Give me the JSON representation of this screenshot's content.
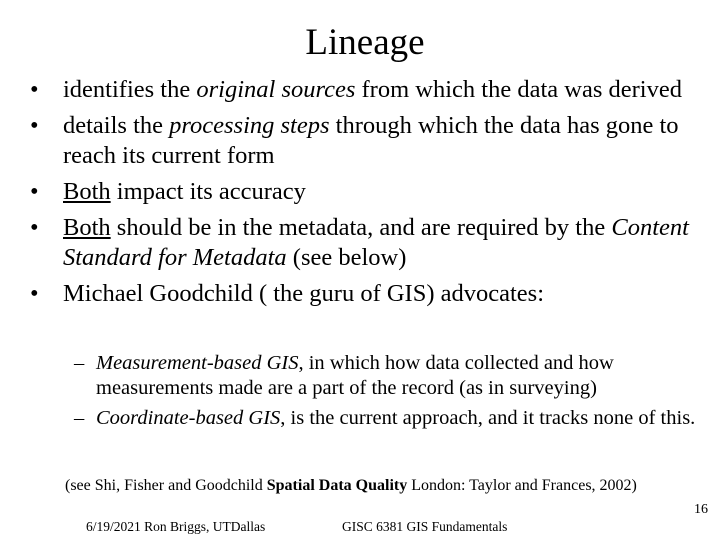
{
  "slide": {
    "title": "Lineage",
    "bullets": [
      {
        "parts": [
          {
            "text": "identifies the ",
            "style": "normal"
          },
          {
            "text": "original sources",
            "style": "italic"
          },
          {
            "text": " from which the data was derived",
            "style": "normal"
          }
        ]
      },
      {
        "parts": [
          {
            "text": "details the ",
            "style": "normal"
          },
          {
            "text": "processing steps",
            "style": "italic"
          },
          {
            "text": " through which the data has gone to reach its current form",
            "style": "normal"
          }
        ]
      },
      {
        "parts": [
          {
            "text": "Both",
            "style": "underline"
          },
          {
            "text": " impact its accuracy",
            "style": "normal"
          }
        ]
      },
      {
        "parts": [
          {
            "text": "Both",
            "style": "underline"
          },
          {
            "text": " should be in the metadata, and are required by the ",
            "style": "normal"
          },
          {
            "text": "Content Standard for Metadata",
            "style": "italic"
          },
          {
            "text": " (see below)",
            "style": "normal"
          }
        ]
      },
      {
        "parts": [
          {
            "text": "Michael Goodchild ( the guru of GIS) advocates:",
            "style": "normal"
          }
        ]
      }
    ],
    "sub_bullets": [
      {
        "parts": [
          {
            "text": "Measurement-based GIS",
            "style": "italic"
          },
          {
            "text": ", in which how data collected and how measurements made are a part of the record (as in surveying)",
            "style": "normal"
          }
        ]
      },
      {
        "parts": [
          {
            "text": "Coordinate-based GIS",
            "style": "italic"
          },
          {
            "text": ", is the current approach, and it tracks none of this.",
            "style": "normal"
          }
        ]
      }
    ],
    "reference": {
      "prefix": "(see  Shi, Fisher and Goodchild ",
      "book": "Spatial Data Quality",
      "suffix": " London:  Taylor and Frances, 2002)"
    },
    "page_number": "16",
    "footer_left": "6/19/2021  Ron Briggs, UTDallas",
    "footer_center": "GISC 6381  GIS  Fundamentals",
    "bullet_glyph": "•",
    "dash_glyph": "–"
  }
}
